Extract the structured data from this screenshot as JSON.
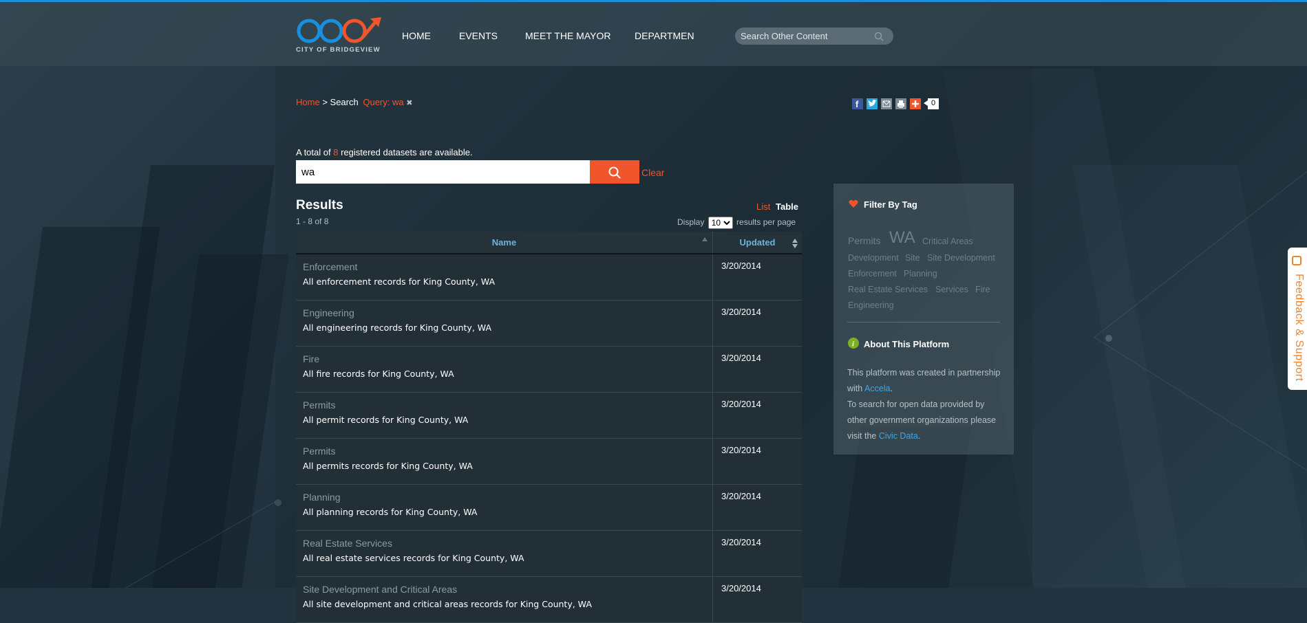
{
  "header": {
    "logo_text": "CITY OF BRIDGEVIEW",
    "nav": [
      "HOME",
      "EVENTS",
      "MEET THE MAYOR",
      "DEPARTMEN"
    ],
    "search_placeholder": "Search Other Content"
  },
  "breadcrumb": {
    "home": "Home",
    "separator": ">",
    "current": "Search",
    "query_label": "Query: wa",
    "close_glyph": "✖"
  },
  "social": {
    "icons": [
      "facebook-icon",
      "twitter-icon",
      "email-icon",
      "print-icon",
      "share-plus-icon"
    ],
    "share_count": "0"
  },
  "summary": {
    "prefix": "A total of",
    "count": "8",
    "suffix": "registered datasets are available."
  },
  "search": {
    "value": "wa",
    "clear_label": "Clear"
  },
  "results": {
    "title": "Results",
    "range": "1 - 8 of 8",
    "view_list": "List",
    "view_table": "Table",
    "display_label": "Display",
    "per_page_value": "10",
    "per_page_suffix": "results per page",
    "col_name": "Name",
    "col_updated": "Updated",
    "rows": [
      {
        "title": "Enforcement",
        "desc": "All enforcement records for King County, WA",
        "updated": "3/20/2014"
      },
      {
        "title": "Engineering",
        "desc": "All engineering records for King County, WA",
        "updated": "3/20/2014"
      },
      {
        "title": "Fire",
        "desc": "All fire records for King County, WA",
        "updated": "3/20/2014"
      },
      {
        "title": "Permits",
        "desc": "All permit records for King County, WA",
        "updated": "3/20/2014"
      },
      {
        "title": "Permits",
        "desc": "All permits records for King County, WA",
        "updated": "3/20/2014"
      },
      {
        "title": "Planning",
        "desc": "All planning records for King County, WA",
        "updated": "3/20/2014"
      },
      {
        "title": "Real Estate Services",
        "desc": "All real estate services records for King County, WA",
        "updated": "3/20/2014"
      },
      {
        "title": "Site Development and Critical Areas",
        "desc": "All site development and critical areas records for King County, WA",
        "updated": "3/20/2014"
      }
    ]
  },
  "sidebar": {
    "filter_title": "Filter By Tag",
    "tags": [
      "Permits",
      "WA",
      "Critical Areas",
      "Development",
      "Site",
      "Site Development",
      "Enforcement",
      "Planning",
      "Real Estate Services",
      "Services",
      "Fire",
      "Engineering"
    ],
    "about_title": "About This Platform",
    "about_p1": "This platform was created in partnership with",
    "about_link1": "Accela",
    "about_p2": "To search for open data provided by other government organizations please visit the",
    "about_link2": "Civic Data"
  },
  "feedback": {
    "label": "Feedback & Support"
  },
  "colors": {
    "accent": "#f0552b",
    "link_blue": "#3ca6ee",
    "top_bar": "#1a8fe0",
    "header_col": "#6cb3dc"
  }
}
